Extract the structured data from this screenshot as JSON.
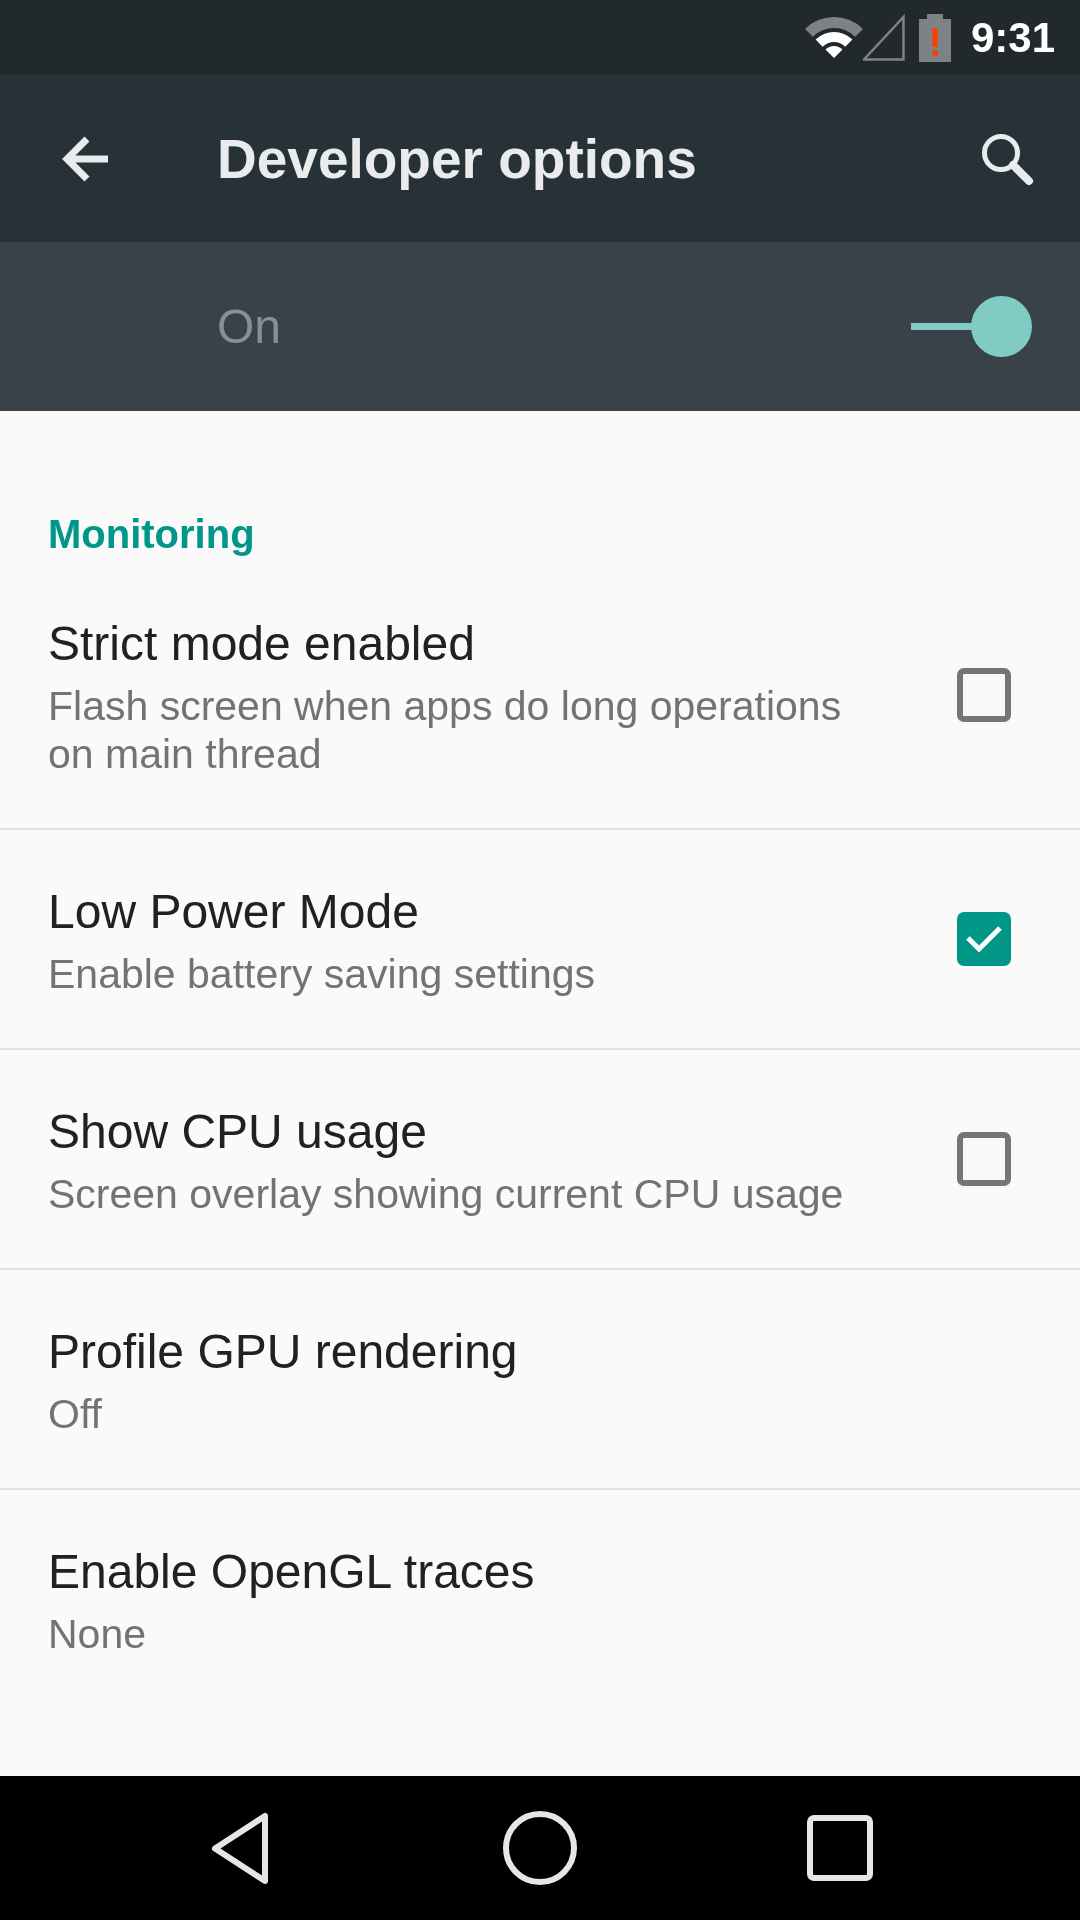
{
  "status_bar": {
    "time": "9:31"
  },
  "app_bar": {
    "title": "Developer options"
  },
  "master_switch": {
    "label": "On",
    "on": true
  },
  "sections": [
    {
      "header": "Monitoring",
      "items": [
        {
          "kind": "checkbox",
          "title": "Strict mode enabled",
          "summary": "Flash screen when apps do long operations on main thread",
          "checked": false
        },
        {
          "kind": "checkbox",
          "title": "Low Power Mode",
          "summary": "Enable battery saving settings",
          "checked": true
        },
        {
          "kind": "checkbox",
          "title": "Show CPU usage",
          "summary": "Screen overlay showing current CPU usage",
          "checked": false
        },
        {
          "kind": "list",
          "title": "Profile GPU rendering",
          "summary": "Off"
        },
        {
          "kind": "list",
          "title": "Enable OpenGL traces",
          "summary": "None"
        }
      ]
    }
  ]
}
